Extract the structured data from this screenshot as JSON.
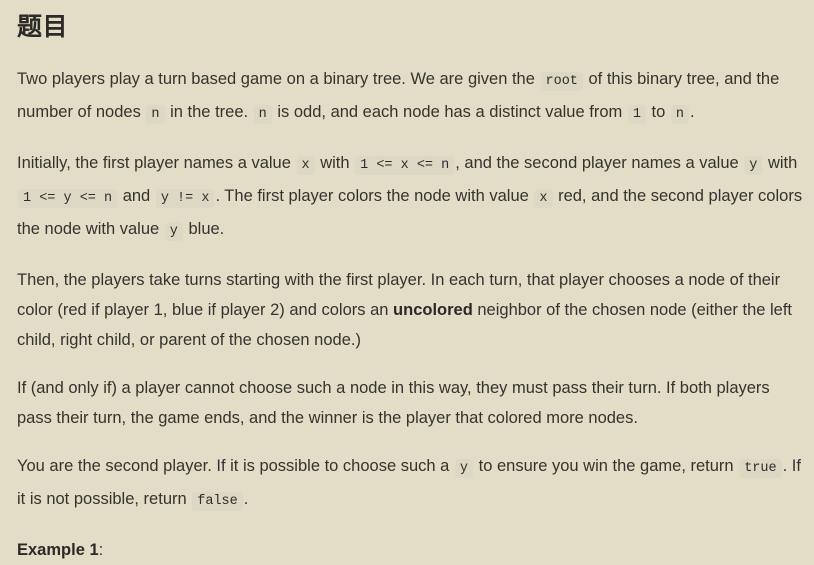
{
  "page": {
    "background_color": "#e3dcc6",
    "text_color": "#35332f",
    "code_background_color": "#dcd8c4"
  },
  "title": "题目",
  "paragraphs": {
    "p1": {
      "t1": "Two players play a turn based game on a binary tree. We are given the ",
      "c1": "root",
      "t2": " of this binary tree, and the number of nodes ",
      "c2": "n",
      "t3": " in the tree. ",
      "c3": "n",
      "t4": " is odd, and each node has a distinct value from ",
      "c4": "1",
      "t5": " to ",
      "c5": "n",
      "t6": "."
    },
    "p2": {
      "t1": "Initially, the first player names a value ",
      "c1": "x",
      "t2": " with ",
      "c2": "1 <= x <= n",
      "t3": ", and the second player names a value ",
      "c3": "y",
      "t4": " with ",
      "c4": "1 <= y <= n",
      "t5": " and ",
      "c5": "y != x",
      "t6": ". The first player colors the node with value ",
      "c6": "x",
      "t7": " red, and the second player colors the node with value ",
      "c7": "y",
      "t8": " blue."
    },
    "p3": {
      "t1": "Then, the players take turns starting with the first player. In each turn, that player chooses a node of their color (red if player 1, blue if player 2) and colors an ",
      "b1": "uncolored",
      "t2": " neighbor of the chosen node (either the left child, right child, or parent of the chosen node.)"
    },
    "p4": {
      "t1": "If (and only if) a player cannot choose such a node in this way, they must pass their turn. If both players pass their turn, the game ends, and the winner is the player that colored more nodes."
    },
    "p5": {
      "t1": "You are the second player. If it is possible to choose such a ",
      "c1": "y",
      "t2": " to ensure you win the game, return ",
      "c2": "true",
      "t3": ". If it is not possible, return ",
      "c3": "false",
      "t4": "."
    },
    "p6": {
      "label": "Example 1",
      "colon": ":"
    }
  }
}
